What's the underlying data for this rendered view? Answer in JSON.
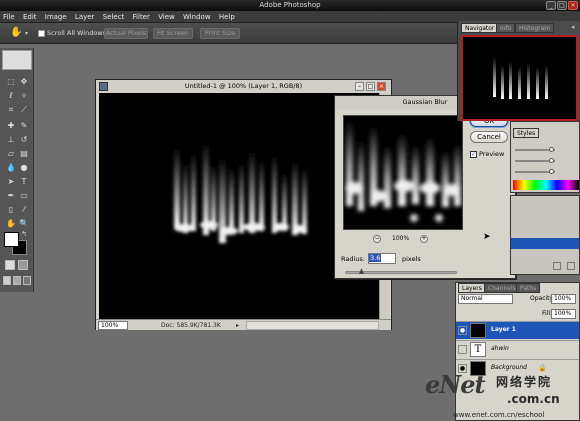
{
  "window": {
    "title": "Adobe Photoshop"
  },
  "menu": [
    "File",
    "Edit",
    "Image",
    "Layer",
    "Select",
    "Filter",
    "View",
    "Window",
    "Help"
  ],
  "options_bar": {
    "scroll_all": "Scroll All Windows",
    "actual_pixels": "Actual Pixels",
    "fit_screen": "Fit Screen",
    "print_size": "Print Size"
  },
  "document": {
    "title": "Untitled-1 @ 100% (Layer 1, RGB/8)",
    "zoom": "100%",
    "doc_info": "Doc: 585.9K/781.3K"
  },
  "dialog": {
    "title": "Gaussian Blur",
    "ok": "OK",
    "cancel": "Cancel",
    "preview_label": "Preview",
    "preview_checked": true,
    "zoom": "100%",
    "radius_label": "Radius:",
    "radius_value": "3.6",
    "radius_unit": "pixels"
  },
  "panels": {
    "navigator_tabs": [
      "Navigator",
      "Info",
      "Histogram"
    ],
    "color_tabs": [
      "Styles"
    ],
    "layers_tabs": [
      "Layers",
      "Channels",
      "Paths"
    ],
    "blend_mode": "Normal",
    "opacity_label": "Opacity:",
    "opacity": "100%",
    "fill_label": "Fill:",
    "fill": "100%",
    "layers": [
      {
        "name": "Layer 1",
        "selected": true
      },
      {
        "name": "ahwin",
        "selected": false
      },
      {
        "name": "Background",
        "selected": false
      }
    ]
  },
  "watermark": {
    "brand": "eNet",
    "cn": "网络学院",
    "domain": ".com.cn",
    "url": "www.enet.com.cn/eschool"
  },
  "colors": {
    "accent": "#1e56b8",
    "bg": "#6e6e6e"
  }
}
